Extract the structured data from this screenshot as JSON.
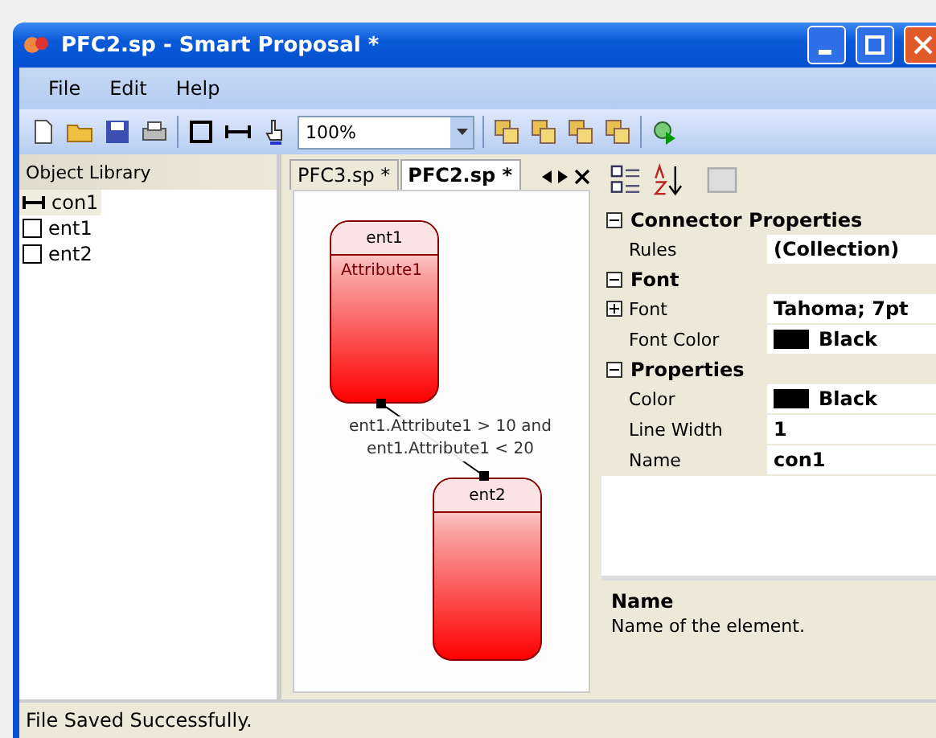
{
  "window": {
    "title": "PFC2.sp - Smart Proposal *"
  },
  "menu": [
    {
      "label": "File"
    },
    {
      "label": "Edit"
    },
    {
      "label": "Help"
    }
  ],
  "toolbar": {
    "zoom": "100%"
  },
  "object_library": {
    "title": "Object Library",
    "items": [
      {
        "label": "con1",
        "kind": "connector",
        "selected": true
      },
      {
        "label": "ent1",
        "kind": "entity",
        "selected": false
      },
      {
        "label": "ent2",
        "kind": "entity",
        "selected": false
      }
    ]
  },
  "tabs": [
    {
      "label": "PFC3.sp *",
      "selected": false
    },
    {
      "label": "PFC2.sp *",
      "selected": true
    }
  ],
  "diagram": {
    "entities": [
      {
        "name": "ent1",
        "attributes": [
          "Attribute1"
        ]
      },
      {
        "name": "ent2"
      }
    ],
    "connector": {
      "label_lines": [
        "ent1.Attribute1 > 10 and",
        "ent1.Attribute1 < 20"
      ]
    }
  },
  "properties": {
    "categories": [
      {
        "title": "Connector Properties",
        "expanded": true,
        "rows": [
          {
            "name": "Rules",
            "value": "(Collection)"
          }
        ]
      },
      {
        "title": "Font",
        "expanded": true,
        "rows": [
          {
            "name": "Font",
            "value": "Tahoma; 7pt",
            "expandable": true
          },
          {
            "name": "Font Color",
            "value": "Black",
            "color": "#000000"
          }
        ]
      },
      {
        "title": "Properties",
        "expanded": true,
        "rows": [
          {
            "name": "Color",
            "value": "Black",
            "color": "#000000"
          },
          {
            "name": "Line Width",
            "value": "1"
          },
          {
            "name": "Name",
            "value": "con1"
          }
        ]
      }
    ],
    "help": {
      "title": "Name",
      "text": "Name of the element."
    }
  },
  "status_bar": "File Saved Successfully."
}
